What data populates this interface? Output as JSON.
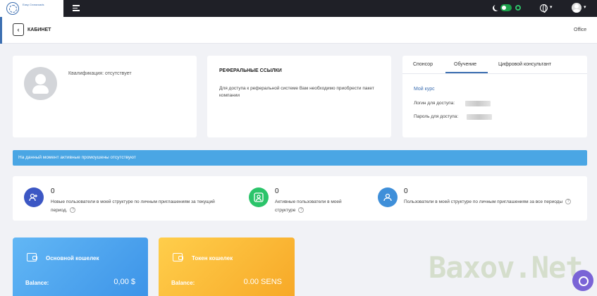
{
  "brand": {
    "logo_text": "Easy Crossroads"
  },
  "header": {
    "back_label": "‹",
    "page_title": "КАБИНЕТ",
    "office_label": "Office"
  },
  "profile": {
    "qualification": "Квалификация: отсутствует"
  },
  "referral": {
    "title": "РЕФЕРАЛЬНЫЕ ССЫЛКИ",
    "text": "Для доступа к реферальной системе Вам необходимо приобрести пакет компании"
  },
  "tabs": [
    {
      "label": "Спонсор",
      "active": false
    },
    {
      "label": "Обучение",
      "active": true
    },
    {
      "label": "Цифровой консультант",
      "active": false
    }
  ],
  "training": {
    "course_link": "Мой курс",
    "login_label": "Логин для доступа:",
    "password_label": "Пароль для доступа:"
  },
  "alert": {
    "text": "На данный момент активные промоушены отсутствуют"
  },
  "stats": [
    {
      "value": "0",
      "label": "Новые пользователи в моей структуре по личным приглашениям за текущий период.",
      "icon": "users-add-icon",
      "color": "#3c57c4"
    },
    {
      "value": "0",
      "label": "Активные пользователи в моей структуре",
      "icon": "user-check-icon",
      "color": "#2bc46a"
    },
    {
      "value": "0",
      "label": "Пользователи в моей структуре по личным приглашениям за все периоды",
      "icon": "users-group-icon",
      "color": "#3f8fd9"
    }
  ],
  "stat_help": "?",
  "wallets": [
    {
      "title": "Основной кошелек",
      "balance_label": "Balance:",
      "amount": "0,00 $",
      "color_from": "#62b7f5",
      "color_to": "#3d94e8"
    },
    {
      "title": "Токен кошелек",
      "balance_label": "Balance:",
      "amount": "0.00 SENS",
      "color_from": "#ffce4b",
      "color_to": "#f7a928"
    }
  ],
  "watermark": "Baxov.Net",
  "colors": {
    "topbar": "#1f2027",
    "accent": "#3d6fb1",
    "alert": "#4aa6e4",
    "background": "#f1f2f6"
  }
}
